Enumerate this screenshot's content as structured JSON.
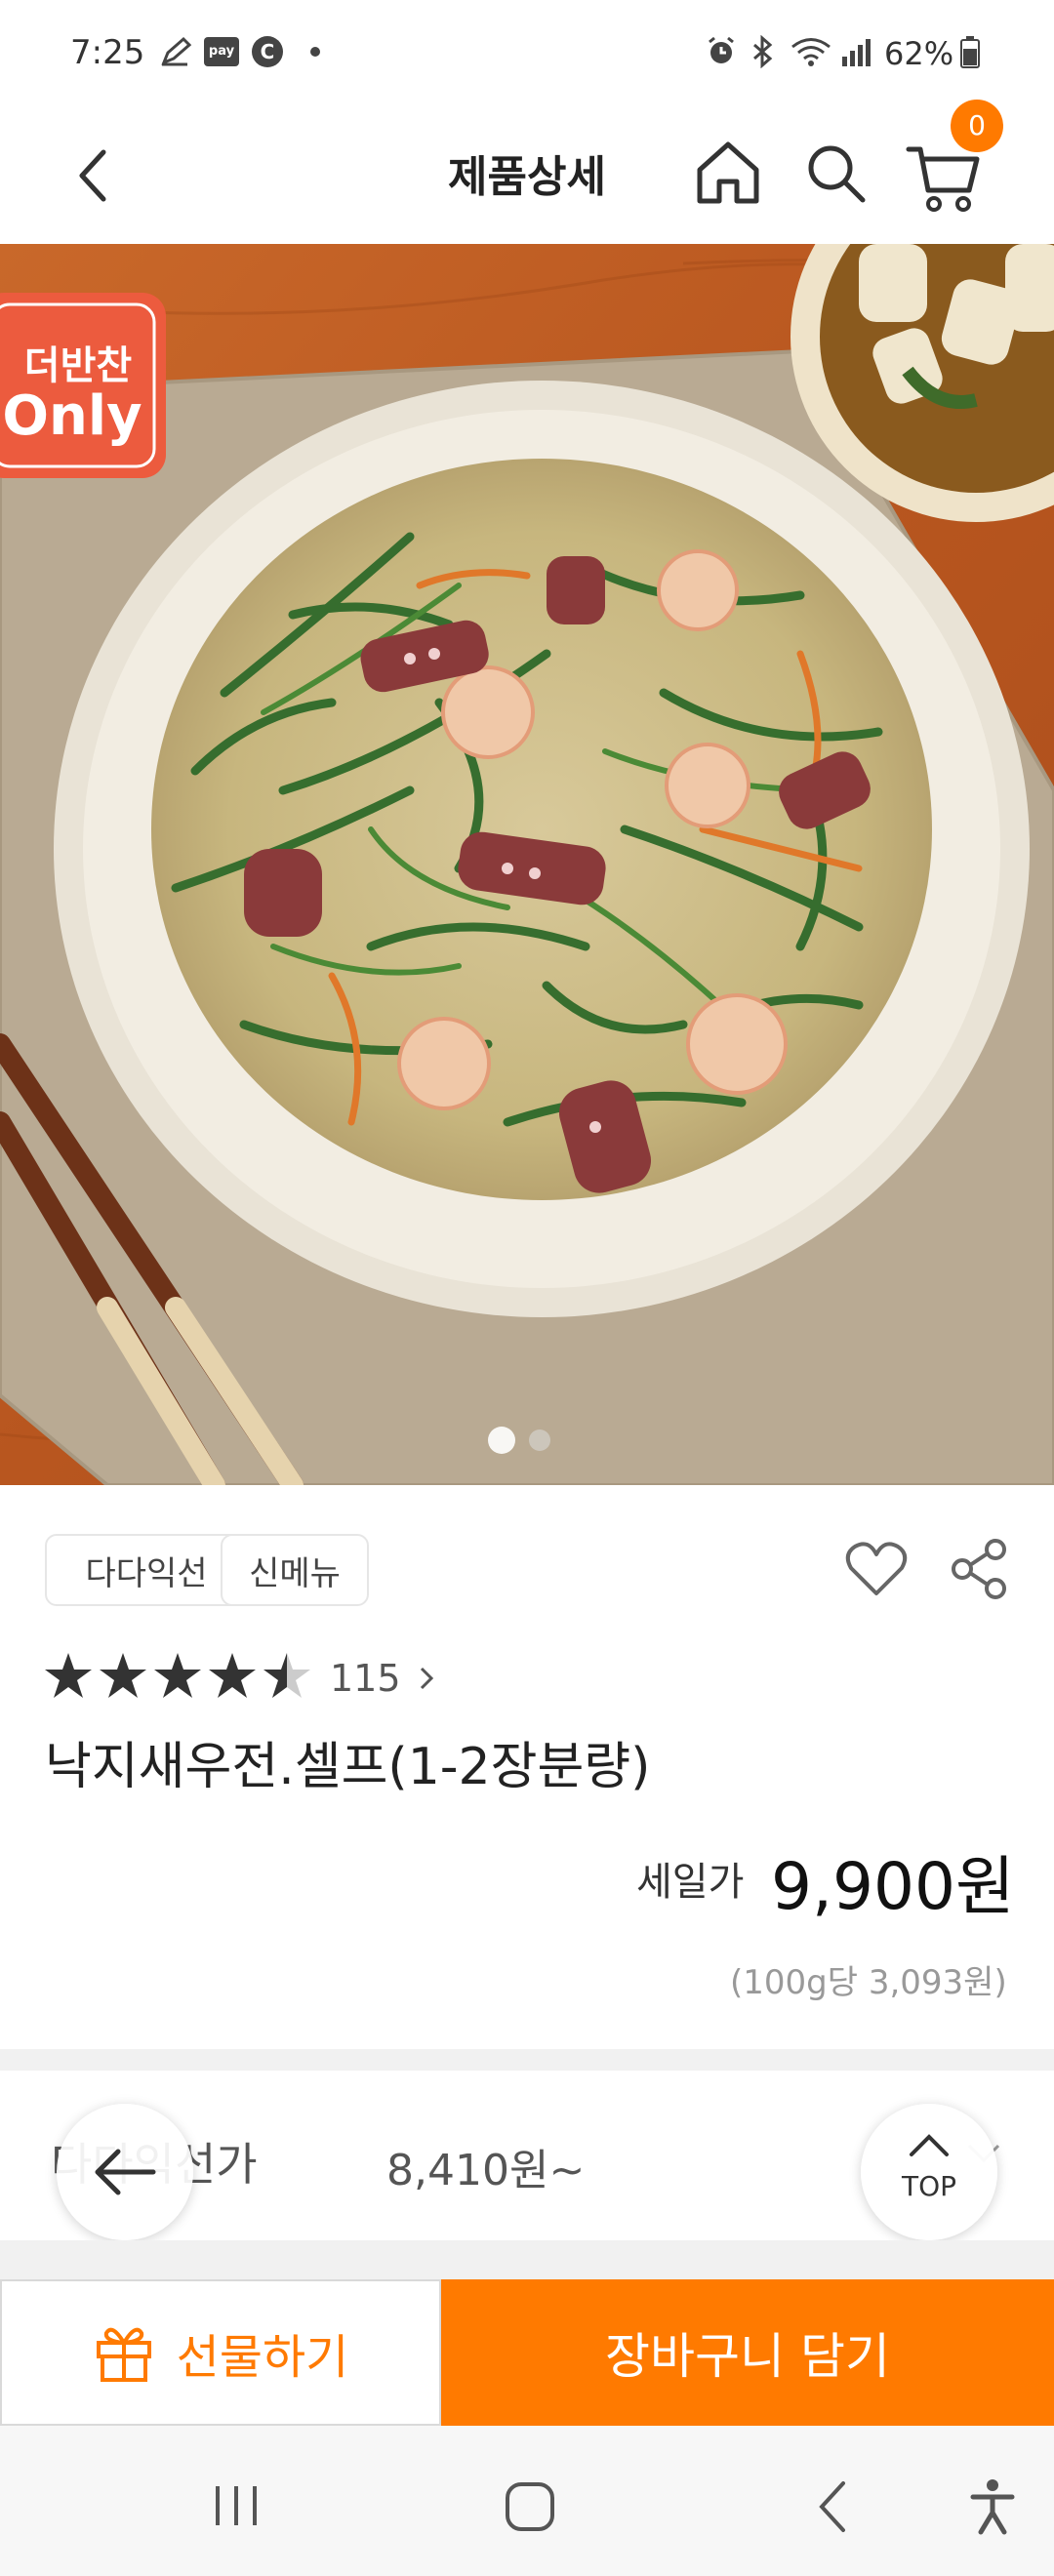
{
  "status_bar": {
    "time": "7:25",
    "battery": "62%"
  },
  "header": {
    "title": "제품상세",
    "cart_count": "0"
  },
  "hero": {
    "badge_line1": "더반찬",
    "badge_line2": "Only",
    "slide_count": 2,
    "active_slide": 1
  },
  "tags": [
    "다다익선",
    "신메뉴"
  ],
  "rating": {
    "stars": 4.5,
    "count": "115"
  },
  "product": {
    "name": "낙지새우전.셀프(1-2장분량)",
    "sale_label": "세일가",
    "sale_price": "9,900원",
    "unit_price": "(100g당 3,093원)"
  },
  "dadaikseon": {
    "label": "다다익선가",
    "price": "8,410원~"
  },
  "buttons": {
    "top_label": "TOP",
    "gift_label": "선물하기",
    "cart_label": "장바구니 담기"
  }
}
